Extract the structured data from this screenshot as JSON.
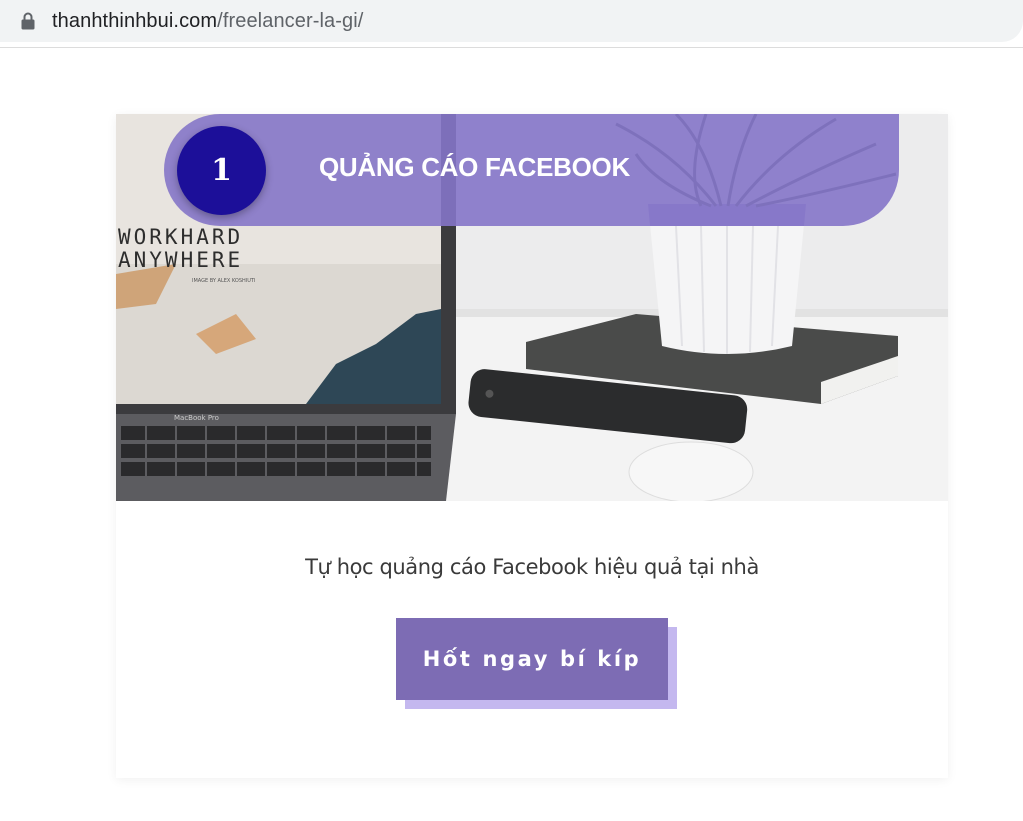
{
  "browser": {
    "url_host": "thanhthinhbui.com",
    "url_path": "/freelancer-la-gi/",
    "icon": "lock-icon"
  },
  "card": {
    "step_number": "1",
    "title": "QUẢNG CÁO FACEBOOK",
    "image_text_line1": "WORKHARD",
    "image_text_line2": "ANYWHERE",
    "image_small_text": "IMAGE BY ALEX KOSHIUTI",
    "laptop_brand": "MacBook Pro",
    "subtitle": "Tự học quảng cáo Facebook hiệu quả tại nhà",
    "cta_label": "Hốt ngay bí kíp"
  },
  "colors": {
    "ribbon": "#8576c8",
    "badge": "#1c0f99",
    "button": "#7d6cb4",
    "button_shadow": "#c4b8ef"
  }
}
